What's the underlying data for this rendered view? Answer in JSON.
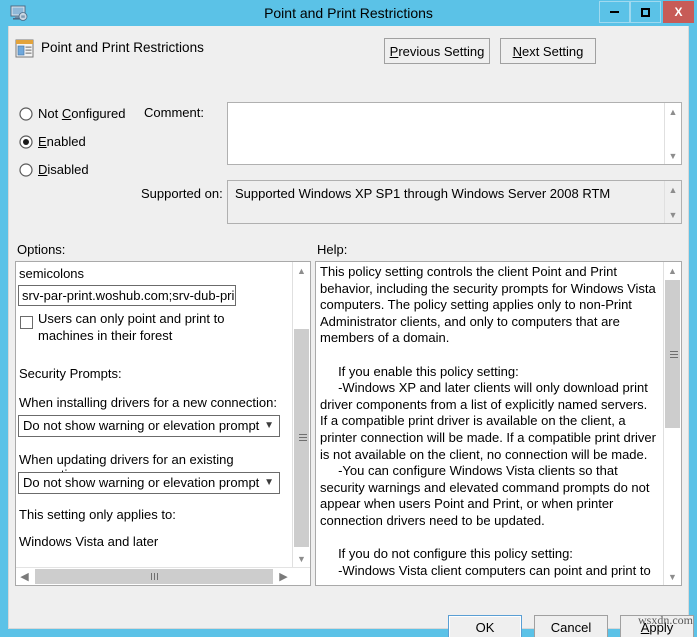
{
  "window": {
    "title": "Point and Print Restrictions",
    "icon": "policy-editor-icon",
    "controls": {
      "minimize": "minimize-icon",
      "maximize": "maximize-icon",
      "close": "X"
    }
  },
  "header": {
    "icon": "policy-setting-icon",
    "title": "Point and Print Restrictions",
    "previous_setting": "Previous Setting",
    "next_setting": "Next Setting"
  },
  "state": {
    "options": [
      "Not Configured",
      "Enabled",
      "Disabled"
    ],
    "selected": "Enabled"
  },
  "comment": {
    "label": "Comment:",
    "value": ""
  },
  "supported": {
    "label": "Supported on:",
    "value": "Supported Windows XP SP1 through Windows Server 2008 RTM"
  },
  "options_panel": {
    "label": "Options:",
    "semicolons_text": "semicolons",
    "servers_value": "srv-par-print.woshub.com;srv-dub-print",
    "forest_checkbox_label": "Users can only point and print to machines in their forest",
    "forest_checked": false,
    "security_prompts_label": "Security Prompts:",
    "install_label": "When installing drivers for a new connection:",
    "install_value": "Do not show warning or elevation prompt",
    "update_label": "When updating drivers for an existing connection:",
    "update_value": "Do not show warning or elevation prompt",
    "applies_to_label": "This setting only applies to:",
    "applies_to_value": "Windows Vista and later"
  },
  "help_panel": {
    "label": "Help:",
    "text": "This policy setting controls the client Point and Print behavior, including the security prompts for Windows Vista computers. The policy setting applies only to non-Print Administrator clients, and only to computers that are members of a domain.\n\n     If you enable this policy setting:\n     -Windows XP and later clients will only download print driver components from a list of explicitly named servers. If a compatible print driver is available on the client, a printer connection will be made. If a compatible print driver is not available on the client, no connection will be made.\n     -You can configure Windows Vista clients so that security warnings and elevated command prompts do not appear when users Point and Print, or when printer connection drivers need to be updated.\n\n     If you do not configure this policy setting:\n     -Windows Vista client computers can point and print to any server.\n     -Windows Vista computers will show a warning and an elevated command prompt when users create a printer"
  },
  "footer": {
    "ok": "OK",
    "cancel": "Cancel",
    "apply": "Apply"
  },
  "watermark": "wsxdn.com",
  "colors": {
    "titlebar": "#5bc2e7",
    "close_button": "#c75b57",
    "dialog_background": "#efefef",
    "focus_border": "#5a9fd4"
  }
}
